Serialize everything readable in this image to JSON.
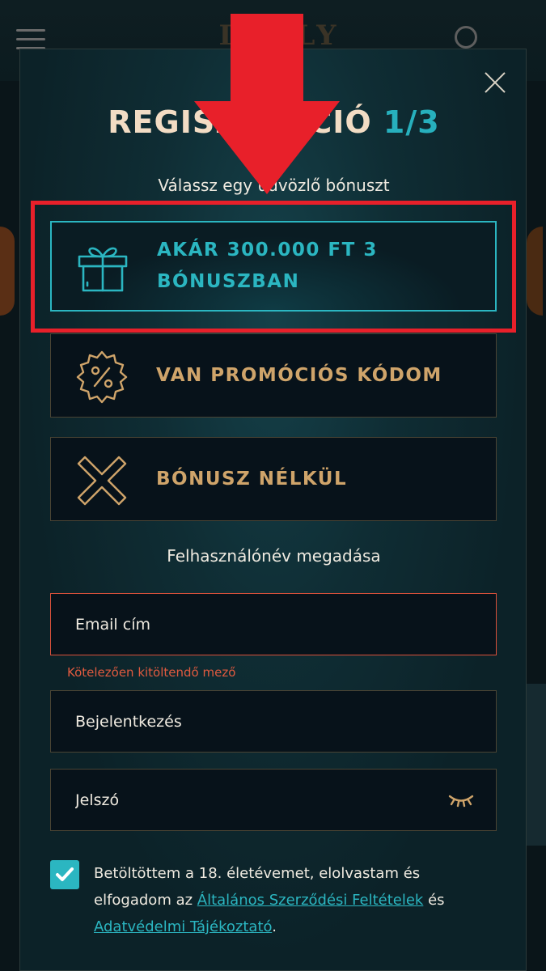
{
  "background": {
    "logo_text": "DOLLY CASINO"
  },
  "modal": {
    "title_main": "REGISZTRÁCIÓ",
    "title_step": "1/3",
    "bonus_prompt": "Válassz egy üdvözlő bónuszt",
    "options": [
      {
        "label": "AKÁR 300.000 FT 3 BÓNUSZBAN",
        "icon": "gift-icon",
        "selected": true
      },
      {
        "label": "VAN PROMÓCIÓS KÓDOM",
        "icon": "percent-badge-icon",
        "selected": false
      },
      {
        "label": "BÓNUSZ NÉLKÜL",
        "icon": "cross-icon",
        "selected": false
      }
    ],
    "username_prompt": "Felhasználónév megadása",
    "email_placeholder": "Email cím",
    "email_error": "Kötelezően kitöltendő mező",
    "login_placeholder": "Bejelentkezés",
    "password_placeholder": "Jelszó",
    "consent_text_1": "Betöltöttem a 18. életévemet, elolvastam és elfogadom az ",
    "terms_link": "Általános Szerződési Feltételek",
    "consent_and": " és ",
    "privacy_link": "Adatvédelmi Tájékoztató",
    "consent_end": "."
  },
  "colors": {
    "accent": "#2bb6c1",
    "gold": "#cfa46a",
    "error": "#d9503a",
    "annotation": "#e8202a"
  }
}
